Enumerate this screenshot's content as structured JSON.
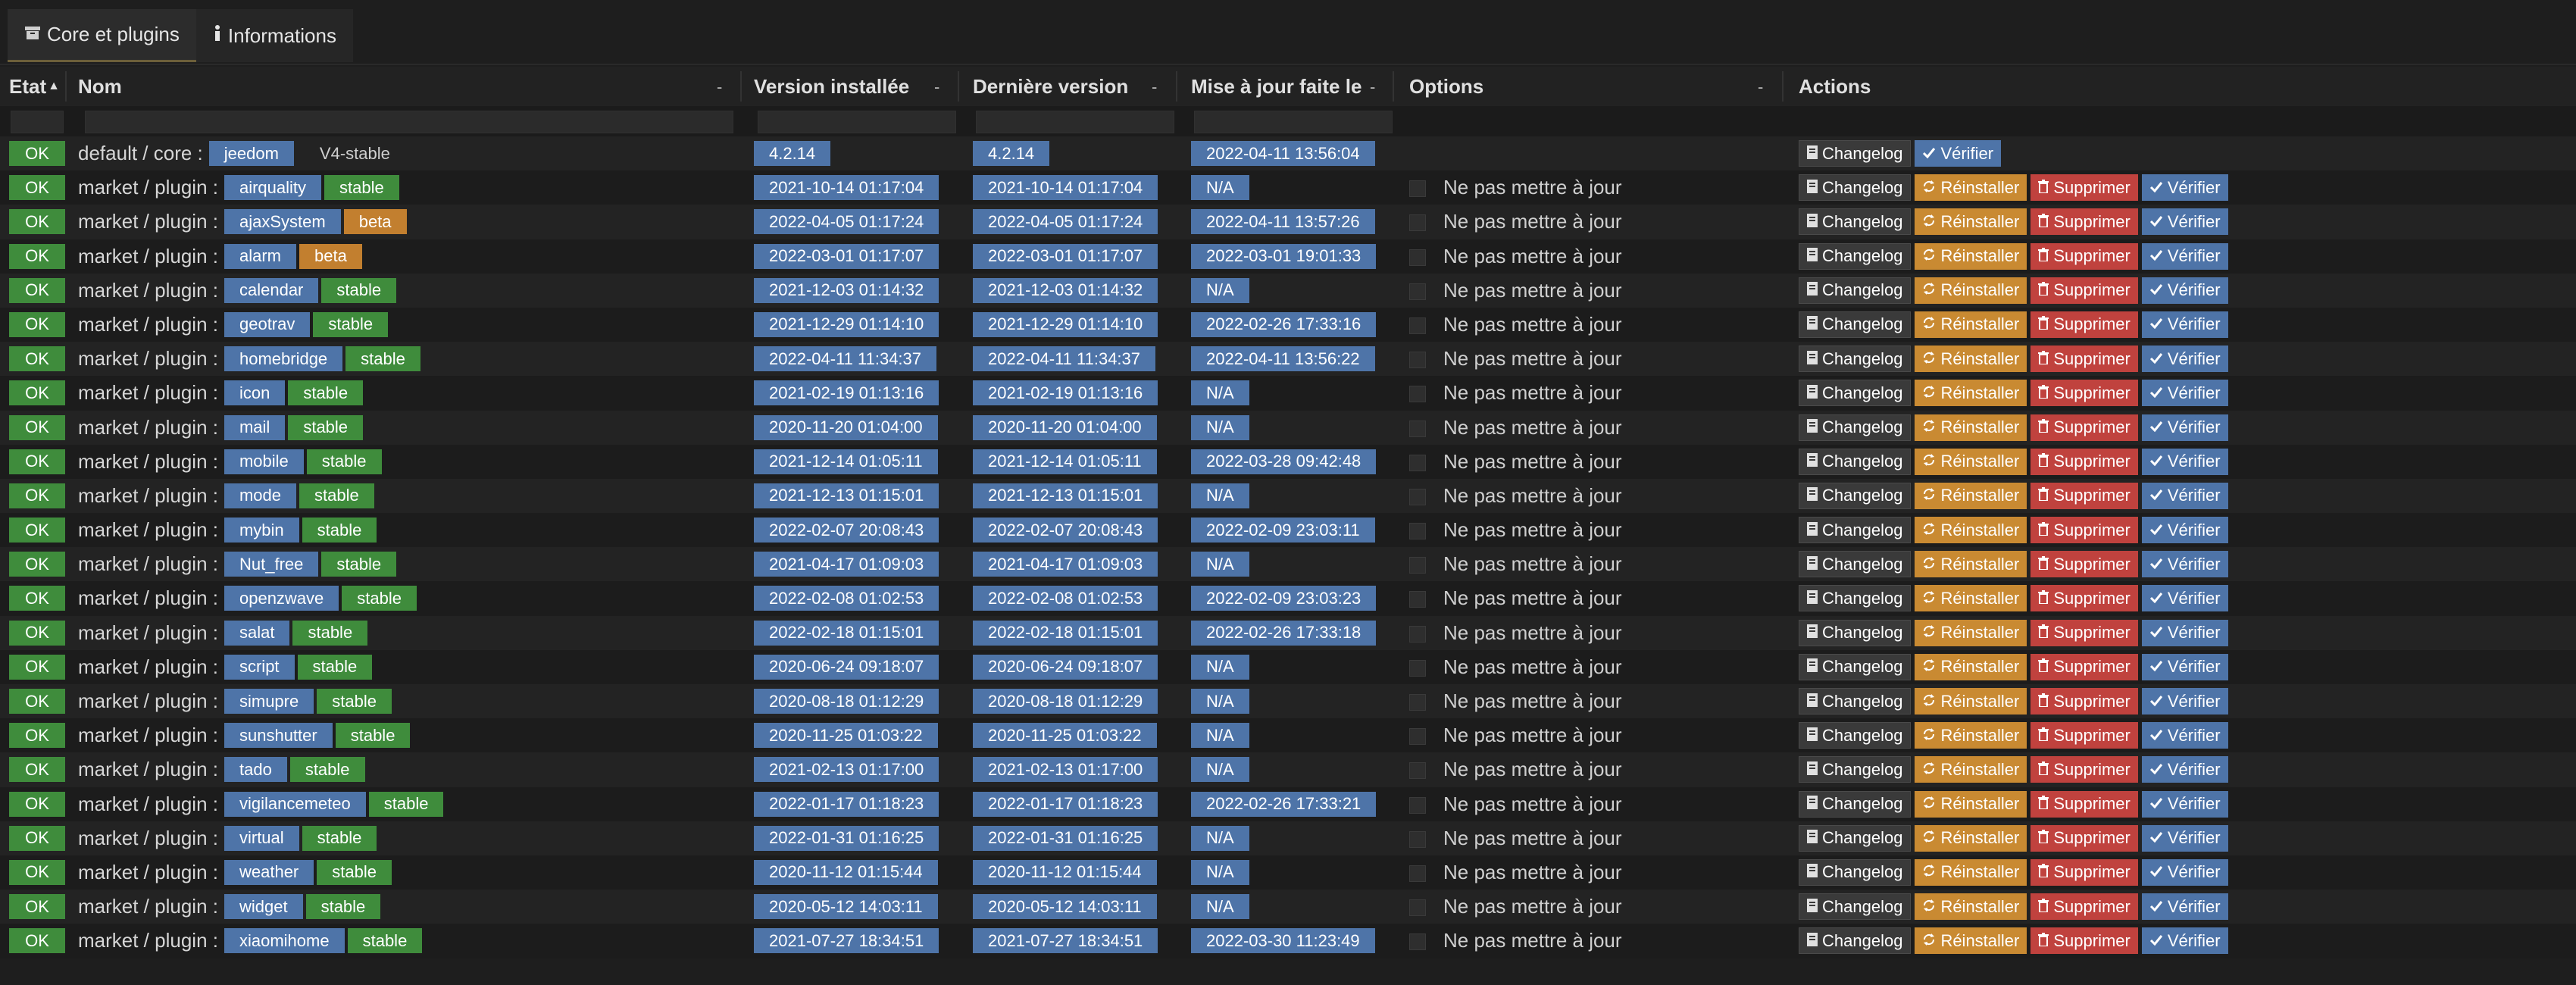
{
  "tabs": [
    {
      "label": "Core et plugins",
      "icon": "archive-icon",
      "active": true
    },
    {
      "label": "Informations",
      "icon": "info-icon",
      "active": false
    }
  ],
  "headers": {
    "etat": "Etat",
    "nom": "Nom",
    "version_installee": "Version installée",
    "derniere_version": "Dernière version",
    "mise_a_jour": "Mise à jour faite le",
    "options": "Options",
    "actions": "Actions"
  },
  "labels": {
    "ok": "OK",
    "core_prefix": "default / core :",
    "plugin_prefix": "market / plugin :",
    "option_text": "Ne pas mettre à jour",
    "changelog": "Changelog",
    "reinstaller": "Réinstaller",
    "supprimer": "Supprimer",
    "verifier": "Vérifier",
    "na": "N/A"
  },
  "colors": {
    "ok_green": "#3f8c3c",
    "blue": "#4e74a8",
    "orange": "#c98a32",
    "red": "#c0423e",
    "background": "#1e1e1e"
  },
  "rows": [
    {
      "type": "core",
      "name": "jeedom",
      "version": "V4-stable",
      "installed": "4.2.14",
      "latest": "4.2.14",
      "updated": "2022-04-11 13:56:04"
    },
    {
      "type": "plugin",
      "name": "airquality",
      "version": "stable",
      "installed": "2021-10-14 01:17:04",
      "latest": "2021-10-14 01:17:04",
      "updated": "N/A"
    },
    {
      "type": "plugin",
      "name": "ajaxSystem",
      "version": "beta",
      "installed": "2022-04-05 01:17:24",
      "latest": "2022-04-05 01:17:24",
      "updated": "2022-04-11 13:57:26"
    },
    {
      "type": "plugin",
      "name": "alarm",
      "version": "beta",
      "installed": "2022-03-01 01:17:07",
      "latest": "2022-03-01 01:17:07",
      "updated": "2022-03-01 19:01:33"
    },
    {
      "type": "plugin",
      "name": "calendar",
      "version": "stable",
      "installed": "2021-12-03 01:14:32",
      "latest": "2021-12-03 01:14:32",
      "updated": "N/A"
    },
    {
      "type": "plugin",
      "name": "geotrav",
      "version": "stable",
      "installed": "2021-12-29 01:14:10",
      "latest": "2021-12-29 01:14:10",
      "updated": "2022-02-26 17:33:16"
    },
    {
      "type": "plugin",
      "name": "homebridge",
      "version": "stable",
      "installed": "2022-04-11 11:34:37",
      "latest": "2022-04-11 11:34:37",
      "updated": "2022-04-11 13:56:22"
    },
    {
      "type": "plugin",
      "name": "icon",
      "version": "stable",
      "installed": "2021-02-19 01:13:16",
      "latest": "2021-02-19 01:13:16",
      "updated": "N/A"
    },
    {
      "type": "plugin",
      "name": "mail",
      "version": "stable",
      "installed": "2020-11-20 01:04:00",
      "latest": "2020-11-20 01:04:00",
      "updated": "N/A"
    },
    {
      "type": "plugin",
      "name": "mobile",
      "version": "stable",
      "installed": "2021-12-14 01:05:11",
      "latest": "2021-12-14 01:05:11",
      "updated": "2022-03-28 09:42:48"
    },
    {
      "type": "plugin",
      "name": "mode",
      "version": "stable",
      "installed": "2021-12-13 01:15:01",
      "latest": "2021-12-13 01:15:01",
      "updated": "N/A"
    },
    {
      "type": "plugin",
      "name": "mybin",
      "version": "stable",
      "installed": "2022-02-07 20:08:43",
      "latest": "2022-02-07 20:08:43",
      "updated": "2022-02-09 23:03:11"
    },
    {
      "type": "plugin",
      "name": "Nut_free",
      "version": "stable",
      "installed": "2021-04-17 01:09:03",
      "latest": "2021-04-17 01:09:03",
      "updated": "N/A"
    },
    {
      "type": "plugin",
      "name": "openzwave",
      "version": "stable",
      "installed": "2022-02-08 01:02:53",
      "latest": "2022-02-08 01:02:53",
      "updated": "2022-02-09 23:03:23"
    },
    {
      "type": "plugin",
      "name": "salat",
      "version": "stable",
      "installed": "2022-02-18 01:15:01",
      "latest": "2022-02-18 01:15:01",
      "updated": "2022-02-26 17:33:18"
    },
    {
      "type": "plugin",
      "name": "script",
      "version": "stable",
      "installed": "2020-06-24 09:18:07",
      "latest": "2020-06-24 09:18:07",
      "updated": "N/A"
    },
    {
      "type": "plugin",
      "name": "simupre",
      "version": "stable",
      "installed": "2020-08-18 01:12:29",
      "latest": "2020-08-18 01:12:29",
      "updated": "N/A"
    },
    {
      "type": "plugin",
      "name": "sunshutter",
      "version": "stable",
      "installed": "2020-11-25 01:03:22",
      "latest": "2020-11-25 01:03:22",
      "updated": "N/A"
    },
    {
      "type": "plugin",
      "name": "tado",
      "version": "stable",
      "installed": "2021-02-13 01:17:00",
      "latest": "2021-02-13 01:17:00",
      "updated": "N/A"
    },
    {
      "type": "plugin",
      "name": "vigilancemeteo",
      "version": "stable",
      "installed": "2022-01-17 01:18:23",
      "latest": "2022-01-17 01:18:23",
      "updated": "2022-02-26 17:33:21"
    },
    {
      "type": "plugin",
      "name": "virtual",
      "version": "stable",
      "installed": "2022-01-31 01:16:25",
      "latest": "2022-01-31 01:16:25",
      "updated": "N/A"
    },
    {
      "type": "plugin",
      "name": "weather",
      "version": "stable",
      "installed": "2020-11-12 01:15:44",
      "latest": "2020-11-12 01:15:44",
      "updated": "N/A"
    },
    {
      "type": "plugin",
      "name": "widget",
      "version": "stable",
      "installed": "2020-05-12 14:03:11",
      "latest": "2020-05-12 14:03:11",
      "updated": "N/A"
    },
    {
      "type": "plugin",
      "name": "xiaomihome",
      "version": "stable",
      "installed": "2021-07-27 18:34:51",
      "latest": "2021-07-27 18:34:51",
      "updated": "2022-03-30 11:23:49"
    }
  ]
}
